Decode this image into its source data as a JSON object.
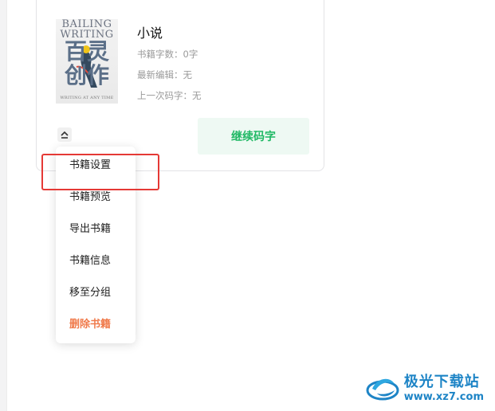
{
  "book": {
    "title": "小说",
    "word_count": "书籍字数：0字",
    "last_edit": "最新编辑：无",
    "last_coding": "上一次码字：无",
    "continue_label": "继续码字",
    "cover": {
      "title_line1": "BAILING",
      "title_line2": "WRITING",
      "art_text": "百灵\n创作",
      "subtitle": "WRITING AT ANY TIME"
    }
  },
  "menu": {
    "items": [
      {
        "label": "书籍设置",
        "danger": false
      },
      {
        "label": "书籍预览",
        "danger": false
      },
      {
        "label": "导出书籍",
        "danger": false
      },
      {
        "label": "书籍信息",
        "danger": false
      },
      {
        "label": "移至分组",
        "danger": false
      },
      {
        "label": "删除书籍",
        "danger": true
      }
    ],
    "highlighted_index": 0
  },
  "watermark": {
    "name": "极光下载站",
    "url": "www.xz7.com"
  },
  "colors": {
    "accent_green": "#1fb864",
    "danger_orange": "#f07b4c",
    "highlight_red": "#e53935",
    "watermark_blue": "#1d84c6"
  }
}
